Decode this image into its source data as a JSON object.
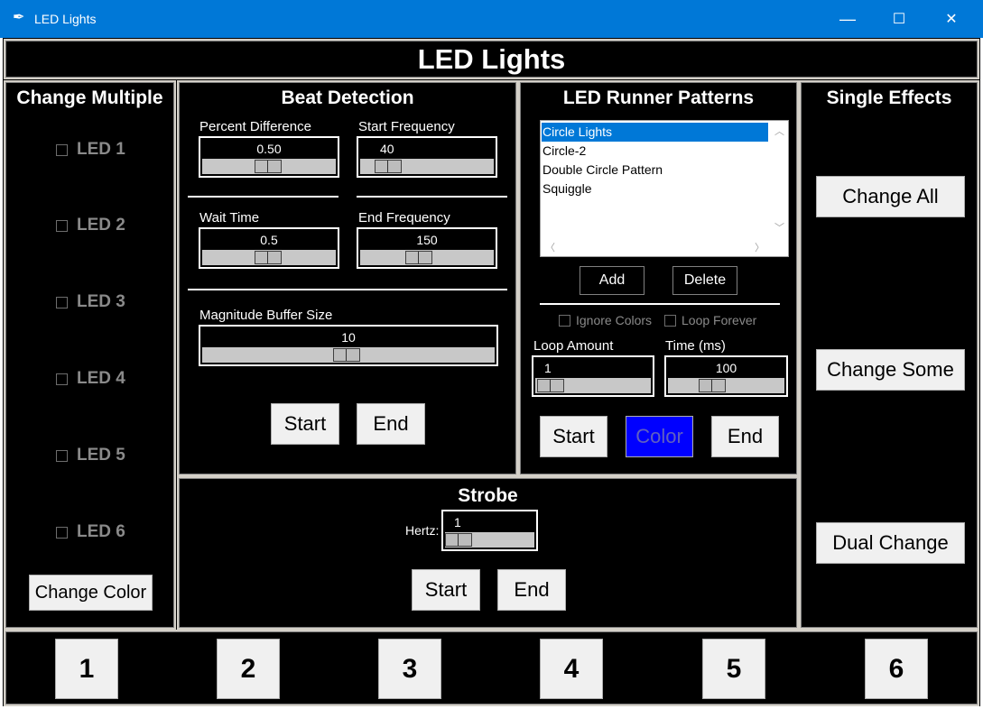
{
  "window": {
    "title": "LED Lights",
    "icon": "feather-icon",
    "minimize": "—",
    "maximize": "☐",
    "close": "✕"
  },
  "header": {
    "title": "LED Lights"
  },
  "change_multiple": {
    "title": "Change Multiple",
    "leds": [
      "LED 1",
      "LED 2",
      "LED 3",
      "LED 4",
      "LED 5",
      "LED 6"
    ],
    "change_color": "Change Color"
  },
  "beat_detection": {
    "title": "Beat Detection",
    "percent_difference": {
      "label": "Percent Difference",
      "value": "0.50"
    },
    "start_frequency": {
      "label": "Start Frequency",
      "value": "40"
    },
    "wait_time": {
      "label": "Wait Time",
      "value": "0.5"
    },
    "end_frequency": {
      "label": "End Frequency",
      "value": "150"
    },
    "magnitude_buffer": {
      "label": "Magnitude Buffer Size",
      "value": "10"
    },
    "start": "Start",
    "end": "End"
  },
  "runner": {
    "title": "LED Runner Patterns",
    "patterns": [
      "Circle Lights",
      "Circle-2",
      "Double Circle Pattern",
      "Squiggle"
    ],
    "selected_index": 0,
    "add": "Add",
    "delete": "Delete",
    "ignore_colors": "Ignore Colors",
    "loop_forever": "Loop Forever",
    "loop_amount": {
      "label": "Loop Amount",
      "value": "1"
    },
    "time": {
      "label": "Time (ms)",
      "value": "100"
    },
    "start": "Start",
    "color": "Color",
    "end": "End"
  },
  "single_effects": {
    "title": "Single Effects",
    "change_all": "Change All",
    "change_some": "Change Some",
    "dual_change": "Dual Change"
  },
  "strobe": {
    "title": "Strobe",
    "hertz_label": "Hertz:",
    "hertz_value": "1",
    "start": "Start",
    "end": "End"
  },
  "presets": [
    "1",
    "2",
    "3",
    "4",
    "5",
    "6"
  ],
  "colors": {
    "titlebar": "#0078d7",
    "background": "#000000",
    "color_button": "#0000ff",
    "selection": "#0078d7"
  }
}
